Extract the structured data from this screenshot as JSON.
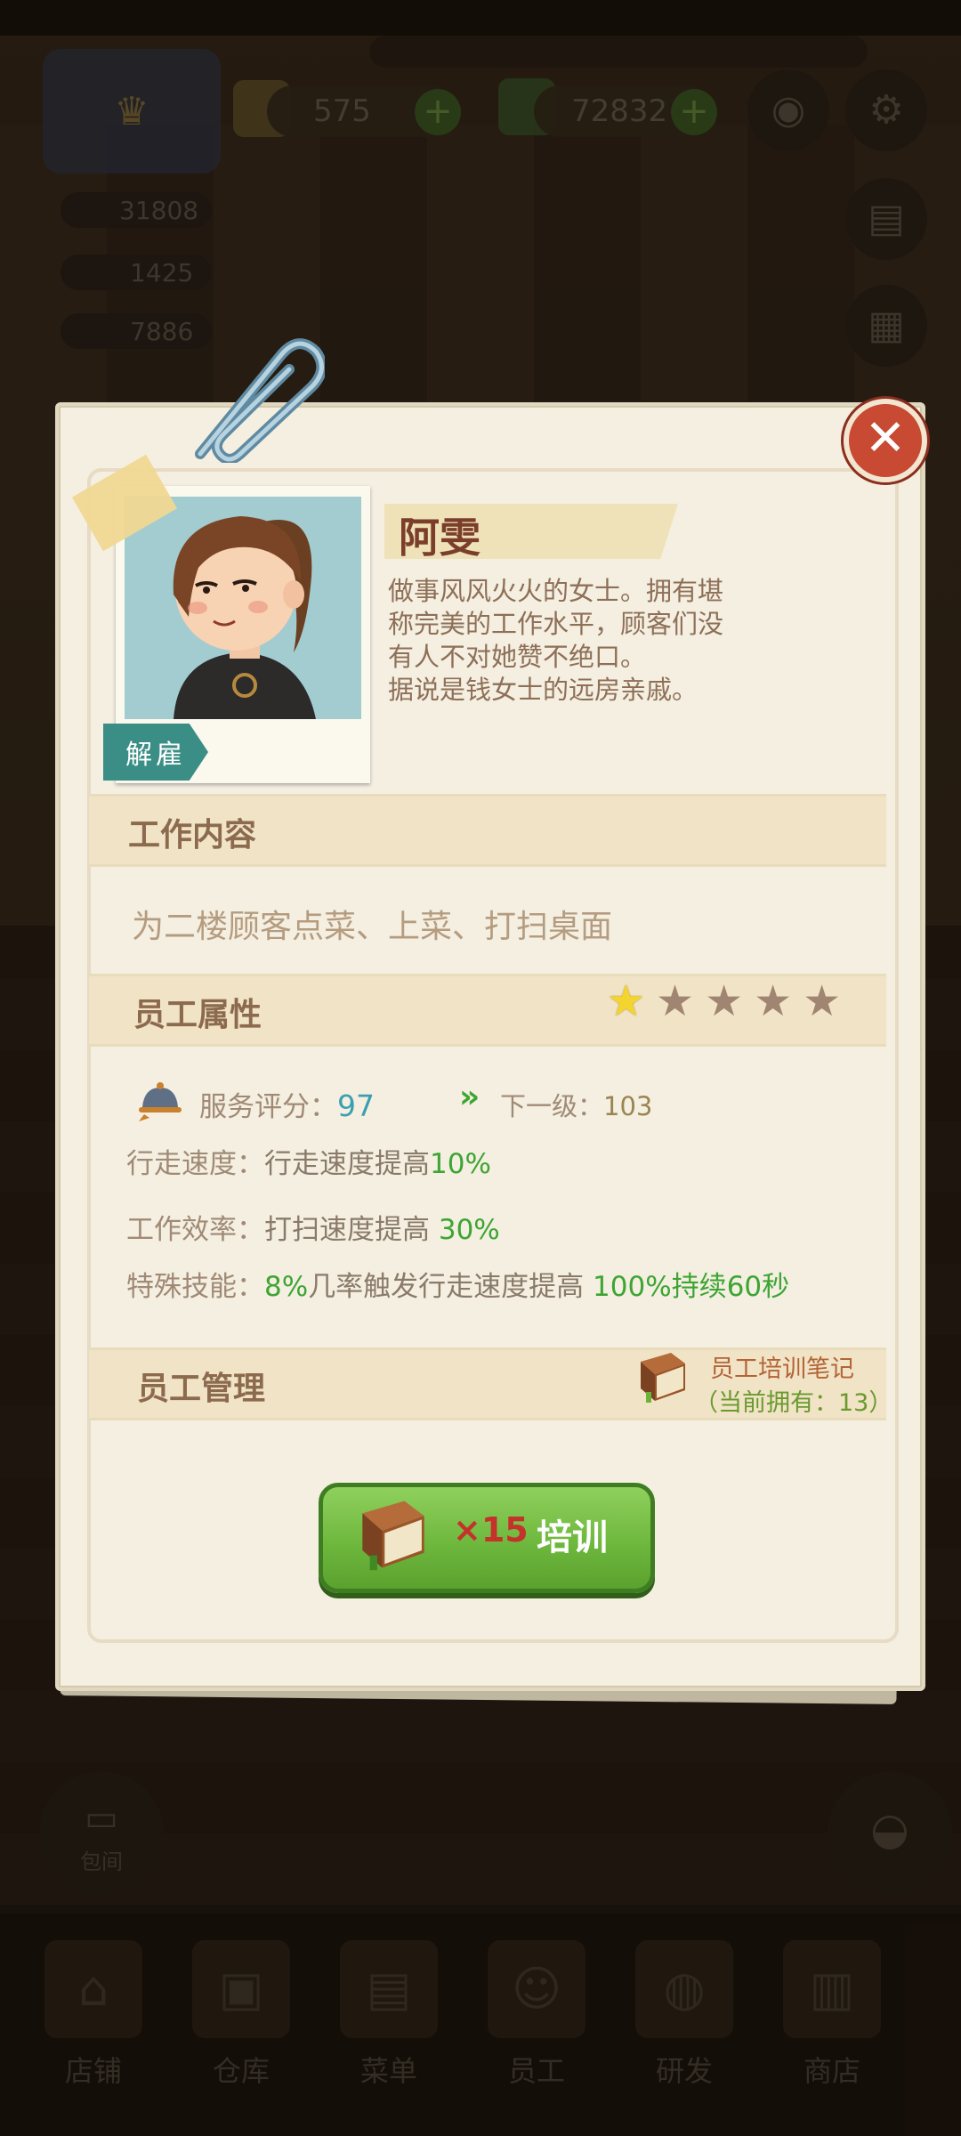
{
  "hud": {
    "gems": "575",
    "cash": "72832",
    "stat1": "31808",
    "stat2": "1425",
    "stat3": "7886"
  },
  "dialog": {
    "name": "阿雯",
    "fire_label": "解雇",
    "description_lines": [
      "做事风风火火的女士。拥有堪",
      "称完美的工作水平，顾客们没",
      "有人不对她赞不绝口。",
      "据说是钱女士的远房亲戚。"
    ],
    "work_section_title": "工作内容",
    "work_text": "为二楼顾客点菜、上菜、打扫桌面",
    "attr_section_title": "员工属性",
    "stars": {
      "filled": 1,
      "total": 5
    },
    "service_label": "服务评分：",
    "service_value": "97",
    "next_label": "下一级：",
    "next_value": "103",
    "walk_label": "行走速度：",
    "walk_text": "行走速度提高",
    "walk_value": "10%",
    "eff_label": "工作效率：",
    "eff_text": "打扫速度提高",
    "eff_value": "30%",
    "skill_label": "特殊技能：",
    "skill_p1": "8%",
    "skill_t1": "几率触发行走速度提高",
    "skill_p2": "100%",
    "skill_t2": "持续",
    "skill_p3": "60秒",
    "manage_section_title": "员工管理",
    "notes_title": "员工培训笔记",
    "notes_owned": "（当前拥有：13）",
    "train_cost": "×15",
    "train_label": "培训"
  },
  "nav": {
    "items": [
      "店铺",
      "仓库",
      "菜单",
      "员工",
      "研发",
      "商店"
    ],
    "private_room": "包间"
  },
  "colors": {
    "accent_green": "#3da534",
    "name_brown": "#7a3e2a",
    "close_red": "#c84a32",
    "fire_teal": "#3b8e86",
    "star_gold": "#f4d42f",
    "star_empty": "#a08572"
  }
}
